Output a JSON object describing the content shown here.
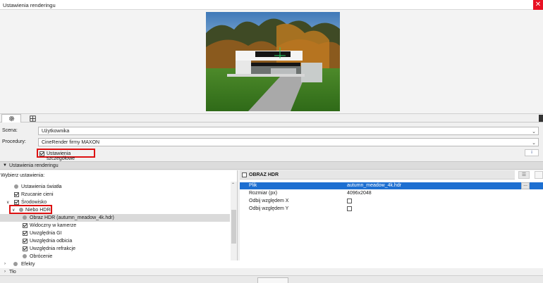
{
  "window": {
    "title": "Ustawienia renderingu",
    "close_glyph": "✕"
  },
  "tabs": [
    {
      "name": "gear-icon",
      "active": true
    },
    {
      "name": "layout-icon",
      "active": false
    }
  ],
  "form": {
    "scene_label": "Scena:",
    "scene_value": "Użytkownika",
    "engine_label": "Procedury:",
    "engine_value": "CineRender firmy MAXON",
    "detailed_settings_label": "Ustawienia szczegółowe",
    "detailed_settings_checked": true,
    "info_button_label": "i"
  },
  "section": {
    "title": "Ustawienia renderingu"
  },
  "tree": {
    "header": "Wybierz ustawienia:",
    "items": [
      {
        "label": "Ustawienia światła",
        "type": "dot",
        "expander": ""
      },
      {
        "label": "Rzucanie cieni",
        "type": "checkbox",
        "checked": true,
        "expander": ""
      },
      {
        "label": "Środowisko",
        "type": "checkbox",
        "checked": true,
        "expander": "∨"
      },
      {
        "label": "Niebo HDRi",
        "type": "dot",
        "expander": "∨"
      },
      {
        "label": "Obraz HDR (autumn_meadow_4k.hdr)",
        "type": "dot",
        "expander": "",
        "selected": true
      },
      {
        "label": "Widoczny w kamerze",
        "type": "checkbox",
        "checked": true,
        "expander": ""
      },
      {
        "label": "Uwzględnia GI",
        "type": "checkbox",
        "checked": true,
        "expander": ""
      },
      {
        "label": "Uwzględnia odbicia",
        "type": "checkbox",
        "checked": true,
        "expander": ""
      },
      {
        "label": "Uwzględnia refrakcje",
        "type": "checkbox",
        "checked": true,
        "expander": ""
      },
      {
        "label": "Obrócenie",
        "type": "dot",
        "expander": ""
      }
    ],
    "collapsed_items": [
      {
        "label": "Efekty",
        "expander": "›"
      },
      {
        "label": "Tło",
        "expander": "›"
      }
    ]
  },
  "properties": {
    "header": "OBRAZ HDR",
    "rows": [
      {
        "key": "Plik",
        "value": "autumn_meadow_4k.hdr",
        "selected": true,
        "has_browse": true,
        "browse_label": "..."
      },
      {
        "key": "Rozmiar (px)",
        "value": "4096x2048"
      },
      {
        "key": "Odbij względem X",
        "checkbox": true,
        "checked": false
      },
      {
        "key": "Odbij względem Y",
        "checkbox": true,
        "checked": false
      }
    ]
  },
  "colors": {
    "accent": "#1d6fd1",
    "highlight_box": "#dd1111",
    "close": "#e81123"
  }
}
